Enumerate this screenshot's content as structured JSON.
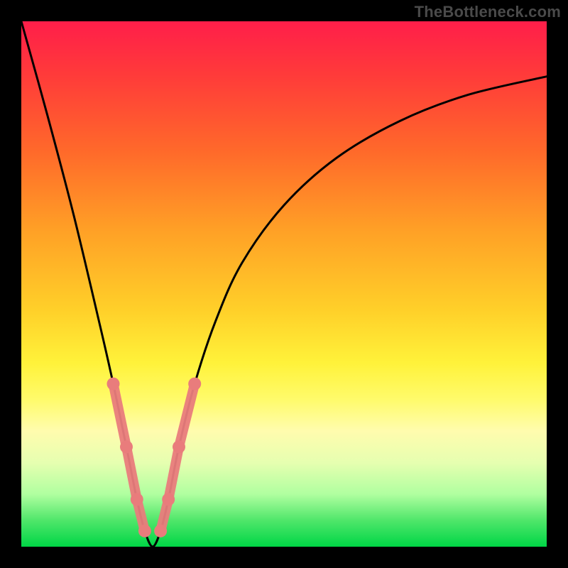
{
  "watermark": "TheBottleneck.com",
  "chart_data": {
    "type": "line",
    "title": "",
    "xlabel": "",
    "ylabel": "",
    "xlim": [
      0,
      100
    ],
    "ylim": [
      0,
      100
    ],
    "x": [
      0,
      5,
      10,
      15,
      17.5,
      20,
      22,
      23.5,
      25,
      26.5,
      28,
      30,
      33,
      37,
      42,
      50,
      60,
      72,
      85,
      100
    ],
    "values": [
      100,
      82,
      63,
      42,
      31,
      19,
      9,
      3,
      0,
      3,
      9,
      19,
      31,
      43,
      54,
      65,
      74,
      81,
      86,
      89.5
    ],
    "series_marker_segments": [
      {
        "side": "left",
        "x": [
          17.5,
          20,
          22,
          23.5
        ],
        "y": [
          31,
          19,
          9,
          3
        ]
      },
      {
        "side": "right",
        "x": [
          26.5,
          28,
          30,
          33
        ],
        "y": [
          3,
          9,
          19,
          31
        ]
      }
    ],
    "colors": {
      "curve": "#000000",
      "marker": "#e97c7c"
    }
  }
}
